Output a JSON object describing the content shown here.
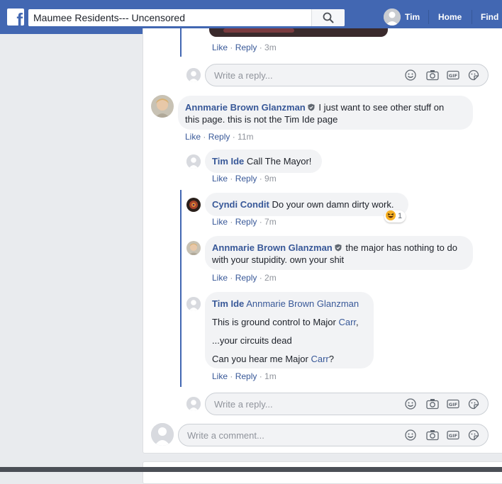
{
  "topbar": {
    "search_value": "Maumee Residents--- Uncensored",
    "user_name": "Tim",
    "nav_home": "Home",
    "nav_find": "Find"
  },
  "top_reply": {
    "like": "Like",
    "reply": "Reply",
    "time": "3m"
  },
  "reply_placeholder": "Write a reply...",
  "comment_placeholder": "Write a comment...",
  "comments": [
    {
      "author": "Annmarie Brown Glanzman",
      "text_line1": "I just want to see other stuff on",
      "text_line2": "this page. this is not the Tim Ide page",
      "like": "Like",
      "reply": "Reply",
      "time": "11m"
    },
    {
      "author": "Tim Ide",
      "text": "Call The Mayor!",
      "like": "Like",
      "reply": "Reply",
      "time": "9m"
    },
    {
      "author": "Cyndi Condit",
      "text": "Do your own damn dirty work.",
      "reaction_count": "1",
      "like": "Like",
      "reply": "Reply",
      "time": "7m"
    },
    {
      "author": "Annmarie Brown Glanzman",
      "text_line1": "the major has nothing to do",
      "text_line2": "with your stupidity. own your shit",
      "like": "Like",
      "reply": "Reply",
      "time": "2m"
    },
    {
      "author": "Tim Ide",
      "mention": "Annmarie Brown Glanzman",
      "line1_pre": "This is ground control to Major ",
      "line1_link": "Carr",
      "line1_post": ",",
      "line2": "...your circuits dead",
      "line3_pre": "Can you hear me Major ",
      "line3_link": "Carr",
      "line3_post": "?",
      "like": "Like",
      "reply": "Reply",
      "time": "1m"
    }
  ],
  "colors": {
    "brand": "#4267b2",
    "link": "#385898",
    "bubble": "#f2f3f5",
    "meta": "#90949c"
  },
  "icons": [
    "facebook-logo-icon",
    "search-icon",
    "shield-icon",
    "emoji-icon",
    "camera-icon",
    "gif-icon",
    "sticker-icon",
    "haha-reaction-icon"
  ]
}
